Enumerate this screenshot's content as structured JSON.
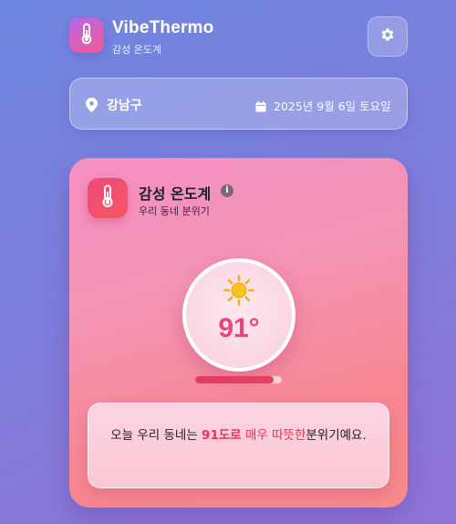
{
  "app": {
    "title": "VibeThermo",
    "subtitle": "감성 온도계"
  },
  "location": {
    "name": "강남구",
    "date": "2025년 9월 6일 토요일"
  },
  "card": {
    "title": "감성 온도계",
    "subtitle": "우리 동네 분위기",
    "temperature": "91°",
    "progress_fraction": 0.91,
    "message": {
      "prefix": "오늘 우리 동네는 ",
      "value": "91도로",
      "middle": " 매우 따뜻한",
      "suffix": "분위기예요."
    }
  },
  "colors": {
    "accent": "#e8457a",
    "background_start": "#6f86e0",
    "background_end": "#8f73d6"
  },
  "icons": {
    "app": "thermometer-icon",
    "settings": "gear-icon",
    "location": "map-pin-icon",
    "date": "calendar-icon",
    "card": "thermometer-icon",
    "info": "info-icon",
    "weather": "sun-icon"
  }
}
